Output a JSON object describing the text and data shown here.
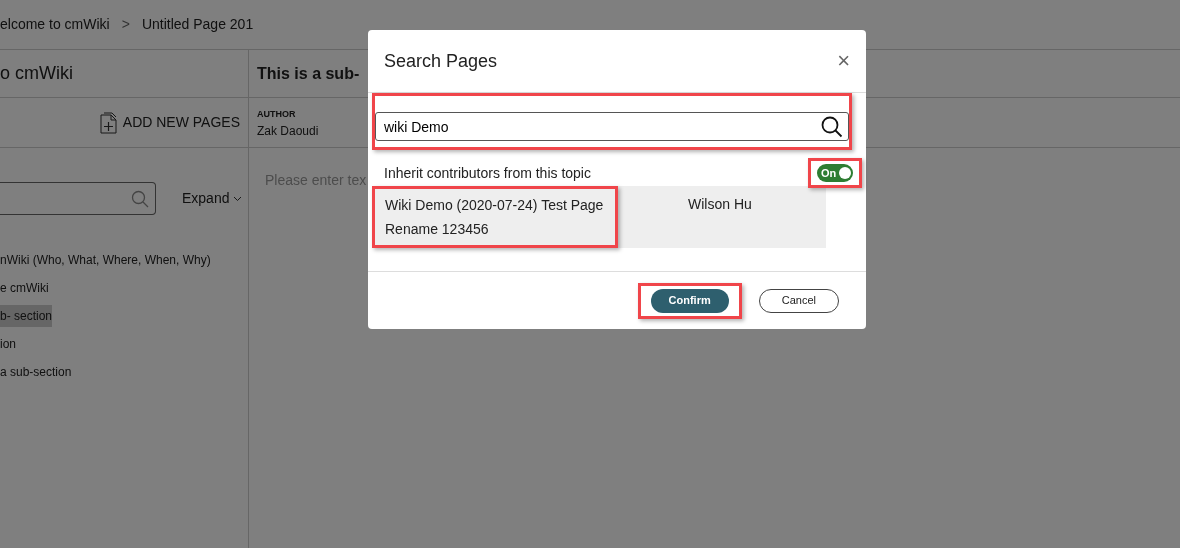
{
  "breadcrumb": [
    {
      "label": "elcome to cmWiki"
    },
    {
      "label": "Untitled Page 201"
    }
  ],
  "breadcrumb_separator": ">",
  "sidebar": {
    "title": "o cmWiki",
    "add_button": "ADD NEW PAGES",
    "expand_button": "Expand",
    "tree": [
      {
        "label": "nWiki (Who, What, Where, When, Why)",
        "selected": false
      },
      {
        "label": "e cmWiki",
        "selected": false
      },
      {
        "label": "b- section",
        "selected": true
      },
      {
        "label": "ion",
        "selected": false
      },
      {
        "label": "a sub-section",
        "selected": false
      }
    ]
  },
  "content": {
    "title": "This is a sub-",
    "author_label": "AUTHOR",
    "author": "Zak Daoudi",
    "placeholder": "Please enter tex"
  },
  "dialog": {
    "title": "Search Pages",
    "close": "×",
    "search": {
      "value": "wiki Demo",
      "highlighted": true
    },
    "inherit": {
      "label": "Inherit contributors from this topic",
      "toggle_text": "On",
      "on": true,
      "highlighted": true
    },
    "results": [
      {
        "title": "Wiki Demo (2020-07-24) Test Page Rename 123456",
        "contributor": "Wilson Hu",
        "highlighted": true
      }
    ],
    "buttons": [
      {
        "label": "Confirm",
        "kind": "primary",
        "highlighted": true
      },
      {
        "label": "Cancel",
        "kind": "secondary",
        "highlighted": false
      }
    ]
  }
}
